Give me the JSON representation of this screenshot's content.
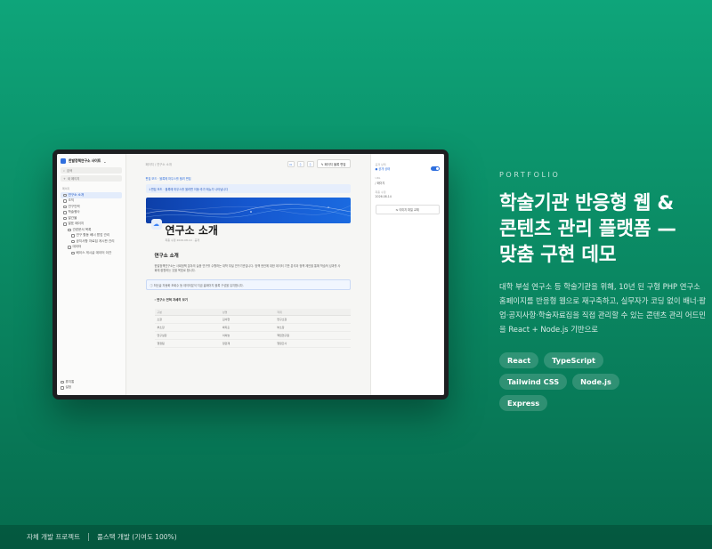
{
  "hero": {
    "eyebrow": "PORTFOLIO",
    "headline_lines": [
      "학술기관 반응형 웹 &",
      "콘텐츠 관리 플랫폼 —",
      "맞춤 구현 데모"
    ],
    "description": "대학 부설 연구소 등 학술기관을 위해, 10년 된 구형 PHP 연구소 홈페이지를 반응형 웹으로 재구축하고, 실무자가 코딩 없이 배너·팝업·공지사항·학술자료집을 직접 관리할 수 있는 콘텐츠 관리 어드민을 React + Node.js 기반으로",
    "tags": [
      "React",
      "TypeScript",
      "Tailwind CSS",
      "Node.js",
      "Express"
    ]
  },
  "footer": {
    "left": "자체 개발 프로젝트",
    "right": "풀스택 개발 (기여도 100%)"
  },
  "screen": {
    "sidebar": {
      "workspace": "한발정책연구소 사이트",
      "search": "검색",
      "new_page": "새 페이지",
      "section": "페이지",
      "items": [
        {
          "label": "연구소 소개",
          "level": 1,
          "active": true
        },
        {
          "label": "조직",
          "level": 1
        },
        {
          "label": "연구인력",
          "level": 1
        },
        {
          "label": "학술행사",
          "level": 1
        },
        {
          "label": "발간물",
          "level": 1
        },
        {
          "label": "발표 페이지",
          "level": 1
        },
        {
          "label": "관련문서 목록",
          "level": 2
        },
        {
          "label": "연구 활동 베너 팝업 관리",
          "level": 3
        },
        {
          "label": "공지사항 자료집 게시판 관리",
          "level": 3
        },
        {
          "label": "데이터",
          "level": 2
        },
        {
          "label": "베이스 게시글 데이터 이관",
          "level": 3
        }
      ],
      "bottom": [
        "휴지통",
        "설정"
      ]
    },
    "topbar": {
      "breadcrumb": "페이지 / 연구소 소개",
      "publish": "페이지 블록 편집"
    },
    "hint": "편집 모드 · 블록에 마우스를 올려 편집",
    "notice": "편집 모드 · 블록에 마우스를 올려면 이동·추가 메뉴가 나타납니다",
    "page": {
      "title": "연구소 소개",
      "meta": "최종 수정 2026.08.14 · 공개",
      "section_title": "연구소 소개",
      "paragraph": "한발정책연구소는 사회정책 분야의 실증 연구를 수행하는 대학 부설 연구기관입니다. 정책 현안에 대한 데이터 기반 분석과 정책 제언을 통해 학술적 성과를 사회에 환원하는 것을 목표로 합니다.",
      "callout": "최신글 자동화 조회수 등 데이터분석 지금 홈페이지 블록 구성을 유지합니다.",
      "toggle": "연구소 연혁 자세히 보기",
      "table": {
        "headers": [
          "구분",
          "성명",
          "직위"
        ],
        "rows": [
          [
            "소장",
            "김서현",
            "연구소장"
          ],
          [
            "부소장",
            "박지훈",
            "부소장"
          ],
          [
            "연구실장",
            "이하늘",
            "책임연구원"
          ],
          [
            "행정팀",
            "정민재",
            "행정간사"
          ]
        ]
      }
    },
    "right_panel": {
      "status_label": "공개 상태",
      "status_value": "공개 상태",
      "field1_label": "URL",
      "field1_value": "/ 페이지",
      "field2_label": "최종 수정",
      "field2_value": "2026.08.14",
      "button": "이미지 파일 교체"
    }
  }
}
